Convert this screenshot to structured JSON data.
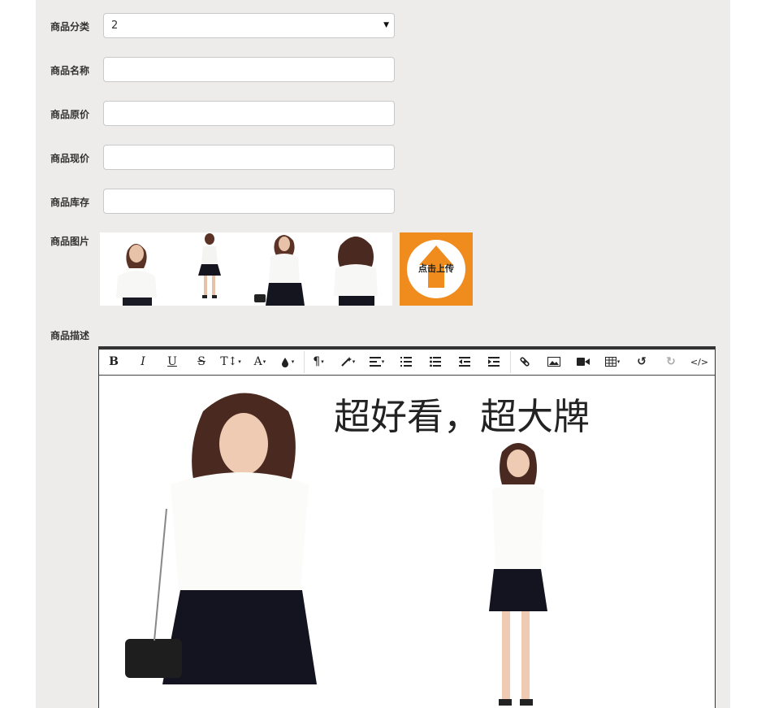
{
  "form": {
    "category": {
      "label": "商品分类",
      "value": "2"
    },
    "name": {
      "label": "商品名称",
      "value": ""
    },
    "original_price": {
      "label": "商品原价",
      "value": ""
    },
    "current_price": {
      "label": "商品现价",
      "value": ""
    },
    "stock": {
      "label": "商品库存",
      "value": ""
    },
    "images": {
      "label": "商品图片",
      "upload_label": "点击上传"
    },
    "description": {
      "label": "商品描述",
      "heading": "超好看，超大牌"
    }
  },
  "toolbar": {
    "bold": "B",
    "italic": "I",
    "underline": "U",
    "strikethrough": "S",
    "font_size": "T↕",
    "font_color": "A",
    "paragraph": "¶",
    "icons": [
      "bold-icon",
      "italic-icon",
      "underline-icon",
      "strikethrough-icon",
      "font-size-icon",
      "font-color-icon",
      "highlight-icon",
      "paragraph-icon",
      "magic-wand-icon",
      "align-icon",
      "ordered-list-icon",
      "unordered-list-icon",
      "outdent-icon",
      "indent-icon",
      "link-icon",
      "image-icon",
      "video-icon",
      "table-icon",
      "undo-icon",
      "redo-icon",
      "code-view-icon"
    ]
  },
  "colors": {
    "panel_bg": "#eeeceb",
    "upload_orange": "#f08c1e",
    "editor_border": "#333333"
  }
}
